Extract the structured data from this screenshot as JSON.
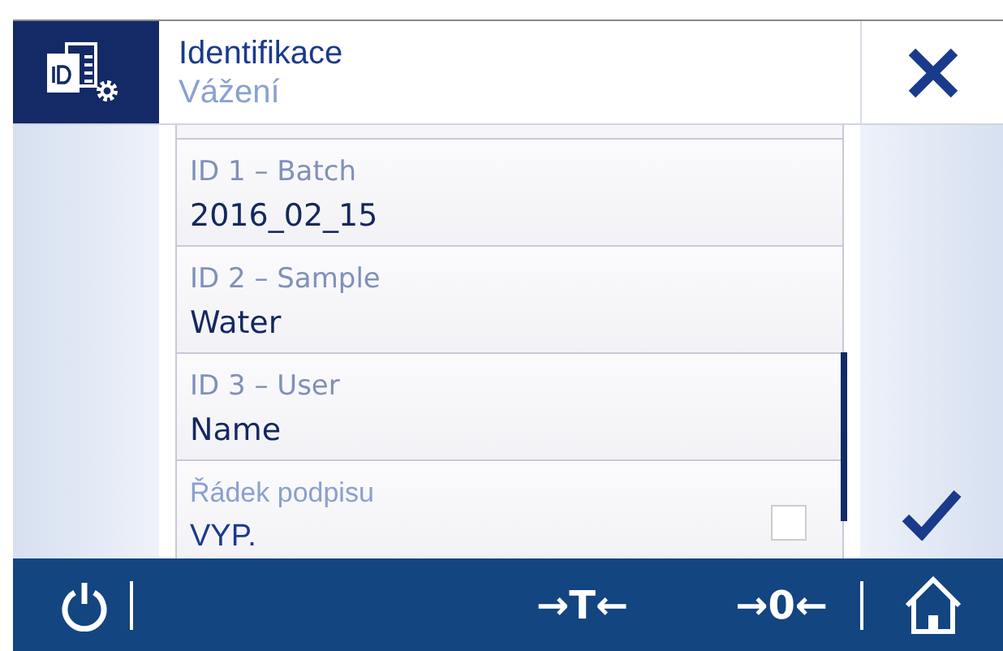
{
  "header": {
    "title": "Identifikace",
    "subtitle": "Vážení"
  },
  "fields": [
    {
      "kind": "text",
      "label": "ID 1 – Batch",
      "value": "2016_02_15"
    },
    {
      "kind": "text",
      "label": "ID 2 – Sample",
      "value": "Water"
    },
    {
      "kind": "text",
      "label": "ID 3 – User",
      "value": "Name"
    },
    {
      "kind": "checkbox",
      "label": "Řádek podpisu",
      "value": "VYP.",
      "checked": false
    }
  ],
  "footer": {
    "keys": [
      {
        "kind": "tare",
        "label": "→T←"
      },
      {
        "kind": "zero",
        "label": "→0←"
      }
    ]
  }
}
